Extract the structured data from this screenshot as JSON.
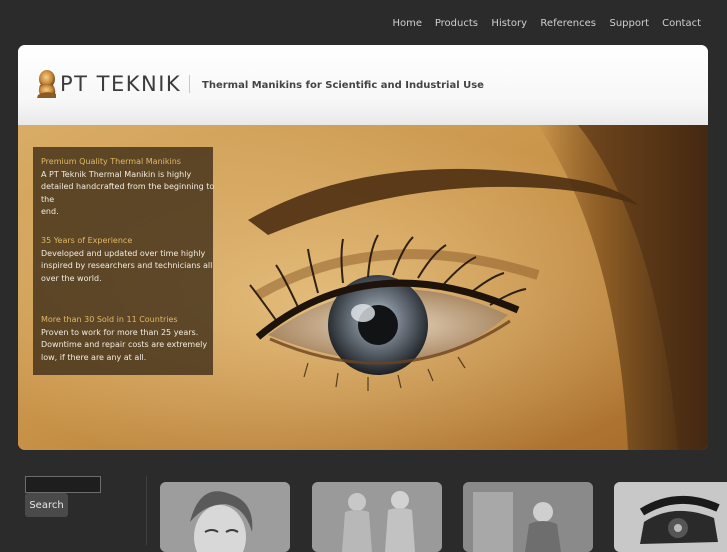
{
  "nav": {
    "items": [
      "Home",
      "Products",
      "History",
      "References",
      "Support",
      "Contact"
    ]
  },
  "header": {
    "logo_text": "PT TEKNIK",
    "tagline": "Thermal Manikins for Scientific and Industrial Use",
    "logo_icon": "manikin-head-icon"
  },
  "info": {
    "sections": [
      {
        "title": "Premium Quality Thermal Manikins",
        "lines": [
          "A PT Teknik Thermal Manikin is highly",
          "detailed handcrafted from the beginning to the",
          "end."
        ]
      },
      {
        "title": "35 Years of Experience",
        "lines": [
          "Developed and updated over time highly",
          "inspired by researchers and technicians all",
          "over the world."
        ]
      },
      {
        "title": "More than 30 Sold in 11 Countries",
        "lines": [
          "Proven to work for more than 25 years.",
          "Downtime and repair costs are extremely",
          "low, if there are any at all."
        ]
      }
    ]
  },
  "search": {
    "placeholder": "",
    "button_label": "Search"
  },
  "colors": {
    "background": "#2b2b2b",
    "accent": "#e3b866",
    "nav_text": "#cfcfcf"
  }
}
